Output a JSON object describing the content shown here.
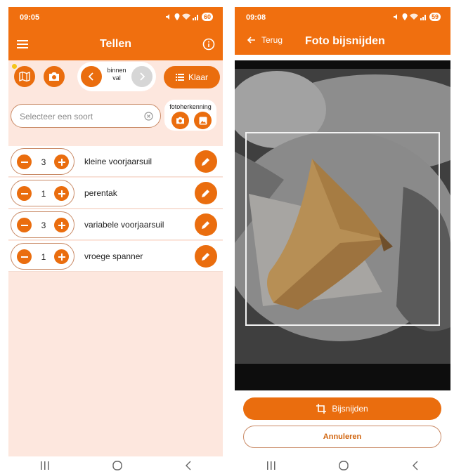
{
  "status_left": {
    "time": "09:05",
    "battery": "60"
  },
  "status_right": {
    "time": "09:08",
    "battery": "59"
  },
  "count_screen": {
    "title": "Tellen",
    "nav_label": "binnen val",
    "done_label": "Klaar",
    "search_placeholder": "Selecteer een soort",
    "photo_recognition_label": "fotoherkenning",
    "entries": [
      {
        "count": "3",
        "name": "kleine voorjaarsuil"
      },
      {
        "count": "1",
        "name": "perentak"
      },
      {
        "count": "3",
        "name": "variabele voorjaarsuil"
      },
      {
        "count": "1",
        "name": "vroege spanner"
      }
    ]
  },
  "crop_screen": {
    "back_label": "Terug",
    "title": "Foto bijsnijden",
    "crop_button_label": "Bijsnijden",
    "cancel_button_label": "Annuleren"
  },
  "colors": {
    "accent": "#ea6d0e",
    "header": "#f06f0f",
    "background": "#fde7de"
  },
  "icons": [
    "menu-icon",
    "info-icon",
    "map-icon",
    "camera-icon",
    "chevron-left-icon",
    "chevron-right-icon",
    "list-icon",
    "clear-icon",
    "gallery-icon",
    "minus-icon",
    "plus-icon",
    "pencil-icon",
    "arrow-left-icon",
    "crop-icon"
  ]
}
